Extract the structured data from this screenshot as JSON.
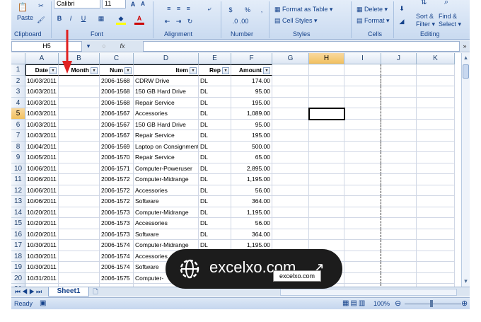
{
  "ribbon": {
    "paste_label": "Paste",
    "font_name": "Calibri",
    "font_size": "11",
    "groups": [
      "Clipboard",
      "Font",
      "Alignment",
      "Number",
      "Styles",
      "Cells",
      "Editing"
    ],
    "format_as_table": "Format as Table",
    "cell_styles": "Cell Styles",
    "delete": "Delete",
    "format": "Format",
    "sort_filter": "Sort &",
    "filter": "Filter",
    "find_select": "Find &",
    "select": "Select",
    "currency": "$",
    "percent": "%",
    "comma": ","
  },
  "formula_bar": {
    "name_box": "H5",
    "fx": "fx",
    "value": ""
  },
  "columns": [
    "A",
    "B",
    "C",
    "D",
    "E",
    "F",
    "G",
    "H",
    "I",
    "J",
    "K"
  ],
  "header_row": [
    "Date",
    "Month",
    "Num",
    "Item",
    "Rep",
    "Amount"
  ],
  "rows": [
    [
      "10/03/2011",
      "",
      "2006-1568",
      "CDRW Drive",
      "DL",
      "174.00"
    ],
    [
      "10/03/2011",
      "",
      "2006-1568",
      "150 GB Hard Drive",
      "DL",
      "95.00"
    ],
    [
      "10/03/2011",
      "",
      "2006-1568",
      "Repair Service",
      "DL",
      "195.00"
    ],
    [
      "10/03/2011",
      "",
      "2006-1567",
      "Accessories",
      "DL",
      "1,089.00"
    ],
    [
      "10/03/2011",
      "",
      "2006-1567",
      "150 GB Hard Drive",
      "DL",
      "95.00"
    ],
    [
      "10/03/2011",
      "",
      "2006-1567",
      "Repair Service",
      "DL",
      "195.00"
    ],
    [
      "10/04/2011",
      "",
      "2006-1569",
      "Laptop on Consignment",
      "DL",
      "500.00"
    ],
    [
      "10/05/2011",
      "",
      "2006-1570",
      "Repair Service",
      "DL",
      "65.00"
    ],
    [
      "10/06/2011",
      "",
      "2006-1571",
      "Computer-Poweruser",
      "DL",
      "2,895.00"
    ],
    [
      "10/06/2011",
      "",
      "2006-1572",
      "Computer-Midrange",
      "DL",
      "1,195.00"
    ],
    [
      "10/06/2011",
      "",
      "2006-1572",
      "Accessories",
      "DL",
      "56.00"
    ],
    [
      "10/06/2011",
      "",
      "2006-1572",
      "Software",
      "DL",
      "364.00"
    ],
    [
      "10/20/2011",
      "",
      "2006-1573",
      "Computer-Midrange",
      "DL",
      "1,195.00"
    ],
    [
      "10/20/2011",
      "",
      "2006-1573",
      "Accessories",
      "DL",
      "56.00"
    ],
    [
      "10/20/2011",
      "",
      "2006-1573",
      "Software",
      "DL",
      "364.00"
    ],
    [
      "10/30/2011",
      "",
      "2006-1574",
      "Computer-Midrange",
      "DL",
      "1,195.00"
    ],
    [
      "10/30/2011",
      "",
      "2006-1574",
      "Accessories",
      "",
      ""
    ],
    [
      "10/30/2011",
      "",
      "2006-1574",
      "Software",
      "",
      ""
    ],
    [
      "10/31/2011",
      "",
      "2006-1575",
      "Computer-",
      "",
      ""
    ],
    [
      "10/31/2011",
      "",
      "2006-1575",
      "Accessories",
      "",
      ""
    ]
  ],
  "row_numbers": [
    "1",
    "2",
    "3",
    "4",
    "5",
    "6",
    "7",
    "8",
    "9",
    "10",
    "11",
    "12",
    "13",
    "14",
    "15",
    "16",
    "17",
    "18",
    "19",
    "20",
    "21"
  ],
  "selected_cell": "H5",
  "sheet_tab": "Sheet1",
  "status": {
    "ready": "Ready",
    "zoom": "100%"
  },
  "overlay": {
    "text": "excelxo.com",
    "tooltip": "excelxo.com"
  },
  "colors": {
    "arrow": "#e02020",
    "selection_header": "#f1c05f",
    "overlay_bg": "#1c1c1c"
  }
}
